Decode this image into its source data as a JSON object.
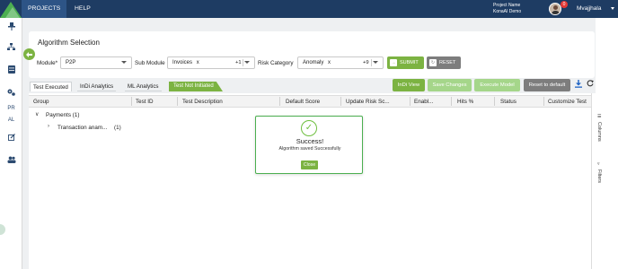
{
  "colors": {
    "nav_bg": "#1e3c63",
    "accent_green": "#7cb342",
    "grey_button": "#7d7d7d",
    "light_green_button": "#a5d68a",
    "link_blue": "#1e63c4"
  },
  "topnav": {
    "tabs": [
      {
        "label": "PROJECTS"
      },
      {
        "label": "HELP"
      }
    ],
    "project_label": "Project Name",
    "project_value": "KonaAI Demo",
    "notification_count": "0",
    "user_name": "Mvajjhala"
  },
  "sidebar": {
    "items": [
      {
        "icon": "pin-icon"
      },
      {
        "icon": "hierarchy-icon"
      },
      {
        "icon": "database-icon"
      },
      {
        "icon": "settings-icon"
      },
      {
        "label": "PR"
      },
      {
        "label": "AL"
      },
      {
        "icon": "edit-icon"
      },
      {
        "icon": "users-icon"
      }
    ]
  },
  "selection": {
    "title": "Algorithm Selection",
    "module_label": "Module*",
    "module_value": "P2P",
    "submodule_label": "Sub Module",
    "submodule_value": "Invoices",
    "submodule_extra": "+1",
    "risk_label": "Risk Category",
    "risk_value": "Anomaly",
    "risk_extra": "+9",
    "remove_glyph": "x",
    "submit_label": "SUBMIT",
    "reset_label": "RESET"
  },
  "tabs": [
    {
      "label": "Test Executed"
    },
    {
      "label": "InDi Analytics"
    },
    {
      "label": "ML Analytics"
    },
    {
      "label": "Test Not Initiated"
    }
  ],
  "actions": {
    "indi_view": "InDi View",
    "save_changes": "Save Changes",
    "execute_model": "Execute Model",
    "reset_default": "Reset to default"
  },
  "table": {
    "columns": [
      "Group",
      "Test ID",
      "Test Description",
      "Default Score",
      "Update Risk Sc...",
      "Enabl...",
      "Hits %",
      "Status",
      "Customize Test"
    ],
    "group_row": "Payments (1)",
    "sub_row": "Transaction anam...",
    "sub_row_count": "(1)"
  },
  "right_panel": {
    "columns_label": "Columns",
    "filters_label": "Filters"
  },
  "modal": {
    "title": "Success!",
    "message": "Algorithm saved Successfully",
    "close_label": "Close"
  }
}
